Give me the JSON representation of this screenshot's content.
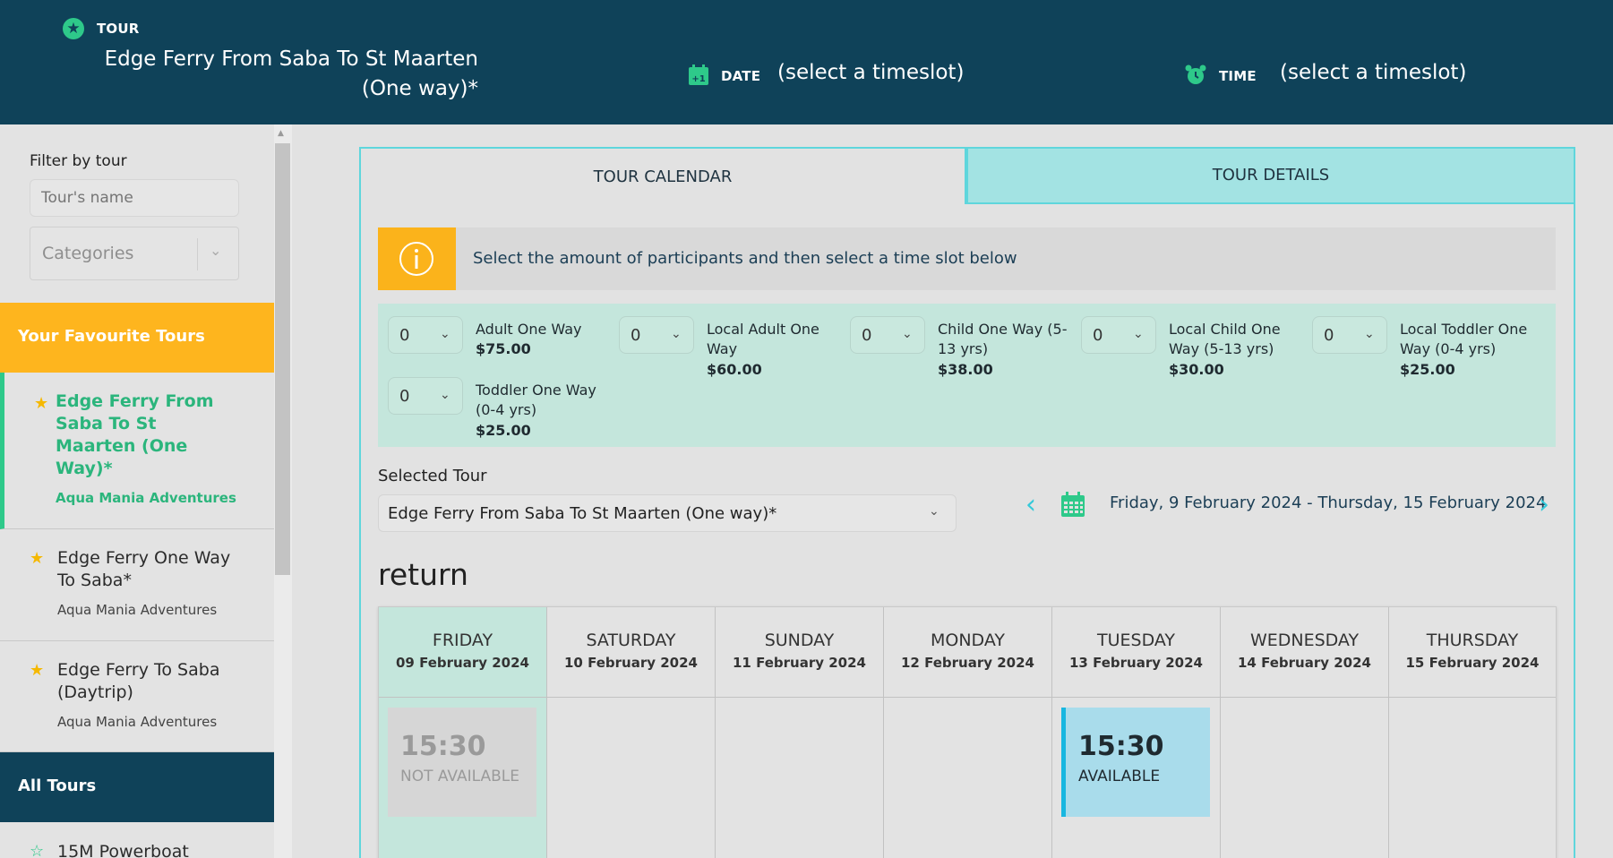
{
  "header": {
    "tour_label": "TOUR",
    "tour_value": "Edge Ferry From Saba To St Maarten (One way)*",
    "date_label": "DATE",
    "date_value": "(select a timeslot)",
    "time_label": "TIME",
    "time_value": "(select a timeslot)",
    "colors": {
      "bg": "#0f4259",
      "accent": "#2ec98a"
    }
  },
  "sidebar": {
    "filter_label": "Filter by tour",
    "filter_placeholder": "Tour's name",
    "categories_placeholder": "Categories",
    "favourites_header": "Your Favourite Tours",
    "favourites": [
      {
        "title": "Edge Ferry From Saba To St Maarten (One Way)*",
        "company": "Aqua Mania Adventures",
        "active": true
      },
      {
        "title": "Edge Ferry One Way To Saba*",
        "company": "Aqua Mania Adventures",
        "active": false
      },
      {
        "title": "Edge Ferry To Saba (Daytrip)",
        "company": "Aqua Mania Adventures",
        "active": false
      }
    ],
    "all_tours_header": "All Tours",
    "all_tours": [
      {
        "title": "15M Powerboat"
      }
    ]
  },
  "tabs": [
    {
      "label": "TOUR CALENDAR",
      "active": true
    },
    {
      "label": "TOUR DETAILS",
      "active": false
    }
  ],
  "info": {
    "text": "Select the amount of participants and then select a time slot below",
    "icon": "info-icon"
  },
  "participants": [
    {
      "qty": "0",
      "name": "Adult One Way",
      "price": "$75.00"
    },
    {
      "qty": "0",
      "name": "Local Adult One Way",
      "price": "$60.00"
    },
    {
      "qty": "0",
      "name": "Child One Way (5-13 yrs)",
      "price": "$38.00"
    },
    {
      "qty": "0",
      "name": "Local Child One Way (5-13 yrs)",
      "price": "$30.00"
    },
    {
      "qty": "0",
      "name": "Local Toddler One Way (0-4 yrs)",
      "price": "$25.00"
    },
    {
      "qty": "0",
      "name": "Toddler One Way (0-4 yrs)",
      "price": "$25.00"
    }
  ],
  "selected_tour": {
    "label": "Selected Tour",
    "value": "Edge Ferry From Saba To St Maarten (One way)*"
  },
  "date_range": "Friday, 9 February 2024 - Thursday, 15 February 2024",
  "section_title": "return",
  "calendar": {
    "days": [
      {
        "name": "FRIDAY",
        "date": "09 February 2024",
        "highlight": true
      },
      {
        "name": "SATURDAY",
        "date": "10 February 2024"
      },
      {
        "name": "SUNDAY",
        "date": "11 February 2024"
      },
      {
        "name": "MONDAY",
        "date": "12 February 2024"
      },
      {
        "name": "TUESDAY",
        "date": "13 February 2024"
      },
      {
        "name": "WEDNESDAY",
        "date": "14 February 2024"
      },
      {
        "name": "THURSDAY",
        "date": "15 February 2024"
      }
    ],
    "slots": [
      {
        "day": "FRIDAY",
        "time": "15:30",
        "status": "NOT AVAILABLE"
      },
      {
        "day": "TUESDAY",
        "time": "15:30",
        "status": "AVAILABLE"
      }
    ],
    "colors": {
      "highlight_day": "#c4e6dc",
      "available": "#a9dceb",
      "unavailable": "#d6d6d6"
    }
  }
}
